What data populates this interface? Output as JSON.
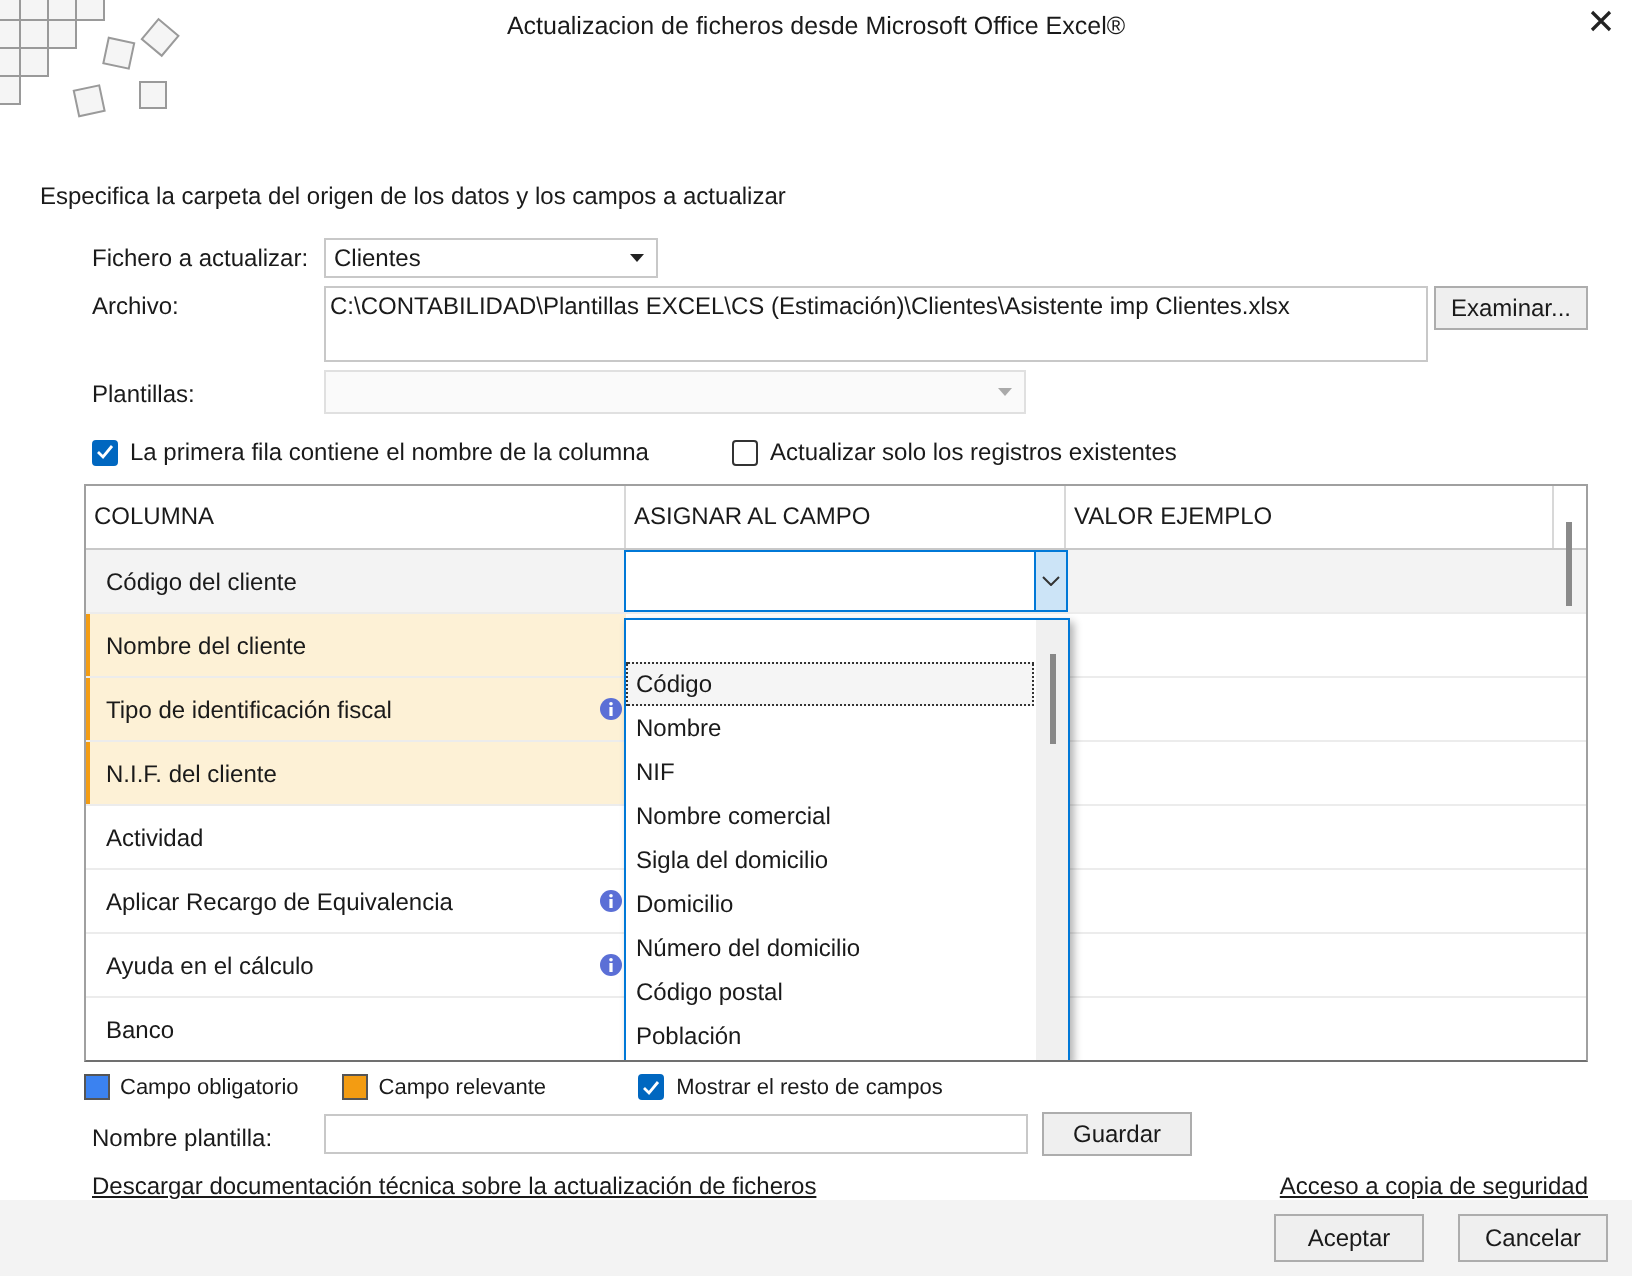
{
  "window": {
    "title": "Actualizacion de ficheros desde Microsoft Office Excel®"
  },
  "instruction": "Especifica la carpeta del origen de los datos y los campos a actualizar",
  "fichero": {
    "label": "Fichero a actualizar:",
    "value": "Clientes"
  },
  "archivo": {
    "label": "Archivo:",
    "value": "C:\\CONTABILIDAD\\Plantillas EXCEL\\CS (Estimación)\\Clientes\\Asistente imp Clientes.xlsx",
    "button": "Examinar..."
  },
  "plantillas": {
    "label": "Plantillas:",
    "disabled": true
  },
  "options": [
    {
      "label": "La primera fila contiene el nombre de la columna",
      "checked": true
    },
    {
      "label": "Actualizar solo los registros existentes",
      "checked": false
    }
  ],
  "table": {
    "columns": [
      "COLUMNA",
      "ASIGNAR AL CAMPO",
      "VALOR EJEMPLO"
    ],
    "rows": [
      {
        "name": "Código del cliente",
        "kind": "normal",
        "selected": true,
        "info": false
      },
      {
        "name": "Nombre del cliente",
        "kind": "relevant",
        "selected": false,
        "info": false
      },
      {
        "name": "Tipo de identificación fiscal",
        "kind": "relevant",
        "selected": false,
        "info": true
      },
      {
        "name": "N.I.F. del cliente",
        "kind": "relevant",
        "selected": false,
        "info": false
      },
      {
        "name": "Actividad",
        "kind": "normal",
        "selected": false,
        "info": false
      },
      {
        "name": "Aplicar Recargo de Equivalencia",
        "kind": "normal",
        "selected": false,
        "info": true
      },
      {
        "name": "Ayuda en el cálculo",
        "kind": "normal",
        "selected": false,
        "info": true
      },
      {
        "name": "Banco",
        "kind": "normal",
        "selected": false,
        "info": false
      }
    ]
  },
  "dropdown": {
    "items": [
      {
        "label": "Código",
        "selected": true
      },
      {
        "label": "Nombre",
        "selected": false
      },
      {
        "label": "NIF",
        "selected": false
      },
      {
        "label": "Nombre comercial",
        "selected": false
      },
      {
        "label": "Sigla del domicilio",
        "selected": false
      },
      {
        "label": "Domicilio",
        "selected": false
      },
      {
        "label": "Número del domicilio",
        "selected": false
      },
      {
        "label": "Código postal",
        "selected": false
      },
      {
        "label": "Población",
        "selected": false
      }
    ]
  },
  "legend": [
    {
      "label": "Campo obligatorio",
      "color": "#3b82f0"
    },
    {
      "label": "Campo relevante",
      "color": "#f39c12"
    }
  ],
  "show_rest": {
    "label": "Mostrar el resto de campos",
    "checked": true
  },
  "template": {
    "label": "Nombre plantilla:",
    "button": "Guardar"
  },
  "links": [
    "Descargar documentación técnica sobre la actualización de ficheros",
    "Acceso a copia de seguridad"
  ],
  "buttons": [
    "Aceptar",
    "Cancelar"
  ]
}
